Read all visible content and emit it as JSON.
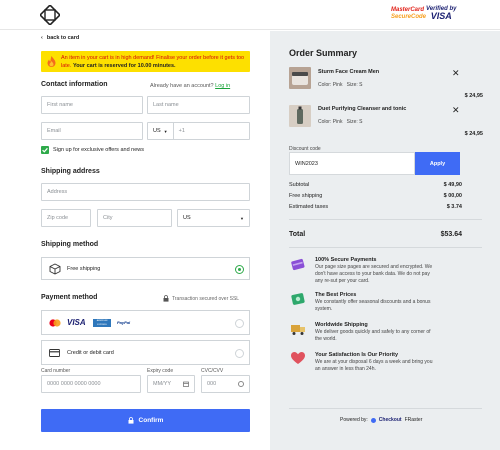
{
  "header": {
    "logo": "checkout-logo",
    "mastercard_line1": "MasterCard",
    "mastercard_line2": "SecureCode",
    "visa_line1": "Verified by",
    "visa_line2": "VISA"
  },
  "back_label": "back to card",
  "alert": {
    "prefix": "An item in your cart is in high demand! Finalise your order before it gets too late. ",
    "emphasis": "Your cart is reserved for 10.00 minutes."
  },
  "contact": {
    "title": "Contact information",
    "account_prompt": "Already have an account?",
    "login_label": "Log in",
    "first_name_placeholder": "First name",
    "last_name_placeholder": "Last name",
    "email_placeholder": "Email",
    "country_code": "US",
    "phone_prefix": "+1",
    "signup_label": "Sign up for exclusive offers and news",
    "signup_checked": true
  },
  "shipping_address": {
    "title": "Shipping address",
    "address_placeholder": "Address",
    "zip_placeholder": "Zip code",
    "city_placeholder": "City",
    "country_value": "US"
  },
  "shipping_method": {
    "title": "Shipping method",
    "option_label": "Free shipping",
    "selected": true
  },
  "payment": {
    "title": "Payment method",
    "secure_note": "Transaction secured over SSL",
    "card_brands": [
      "MasterCard",
      "VISA",
      "AMERICAN EXPRESS",
      "PayPal"
    ],
    "card_option_label": "Credit or debit card",
    "card_number_label": "Card number",
    "card_number_placeholder": "0000  0000  0000  0000",
    "expiry_label": "Expiry code",
    "expiry_placeholder": "MM/YY",
    "cvc_label": "CVC/CVV",
    "cvc_placeholder": "000"
  },
  "confirm_label": "Confirm",
  "summary": {
    "title": "Order Summary",
    "items": [
      {
        "name": "Sturm Face Cream Men",
        "color": "Color: Pink",
        "size": "Size: S",
        "price": "$ 24,95"
      },
      {
        "name": "Duet Purifying Cleanser and tonic",
        "color": "Color: Pink",
        "size": "Size: S",
        "price": "$ 24,95"
      }
    ],
    "discount_label": "Discount code",
    "discount_value": "WIN2023",
    "apply_label": "Apply",
    "subtotal_label": "Subtotal",
    "subtotal_value": "$ 49,90",
    "shipping_label": "Free shipping",
    "shipping_value": "$ 00,00",
    "taxes_label": "Estimated taxes",
    "taxes_value": "$ 3.74",
    "total_label": "Total",
    "total_value": "$53.64"
  },
  "features": [
    {
      "title": "100% Secure Payments",
      "desc": "Our page size pages are secured and encrypted. We don't have access to your bank data. We do not pay any re-sut per your card."
    },
    {
      "title": "The Best Prices",
      "desc": "We constantly offer seasonal discounts and a bonus system."
    },
    {
      "title": "Worldwide Shipping",
      "desc": "We deliver goods quickly and safely to any corner of the world."
    },
    {
      "title": "Your Satisfaction Is Our Priority",
      "desc": "We are at your disposal 6 days a week and bring you an answer in less than 24h."
    }
  ],
  "powered": {
    "label": "Powered by:",
    "brand_a": "Checkout",
    "brand_b": "FRaster"
  },
  "colors": {
    "accent_blue": "#3f6bf5",
    "alert_yellow": "#fde000",
    "alert_red": "#d60b0b",
    "success_green": "#2eaa4a",
    "summary_bg": "#ebeef0"
  }
}
